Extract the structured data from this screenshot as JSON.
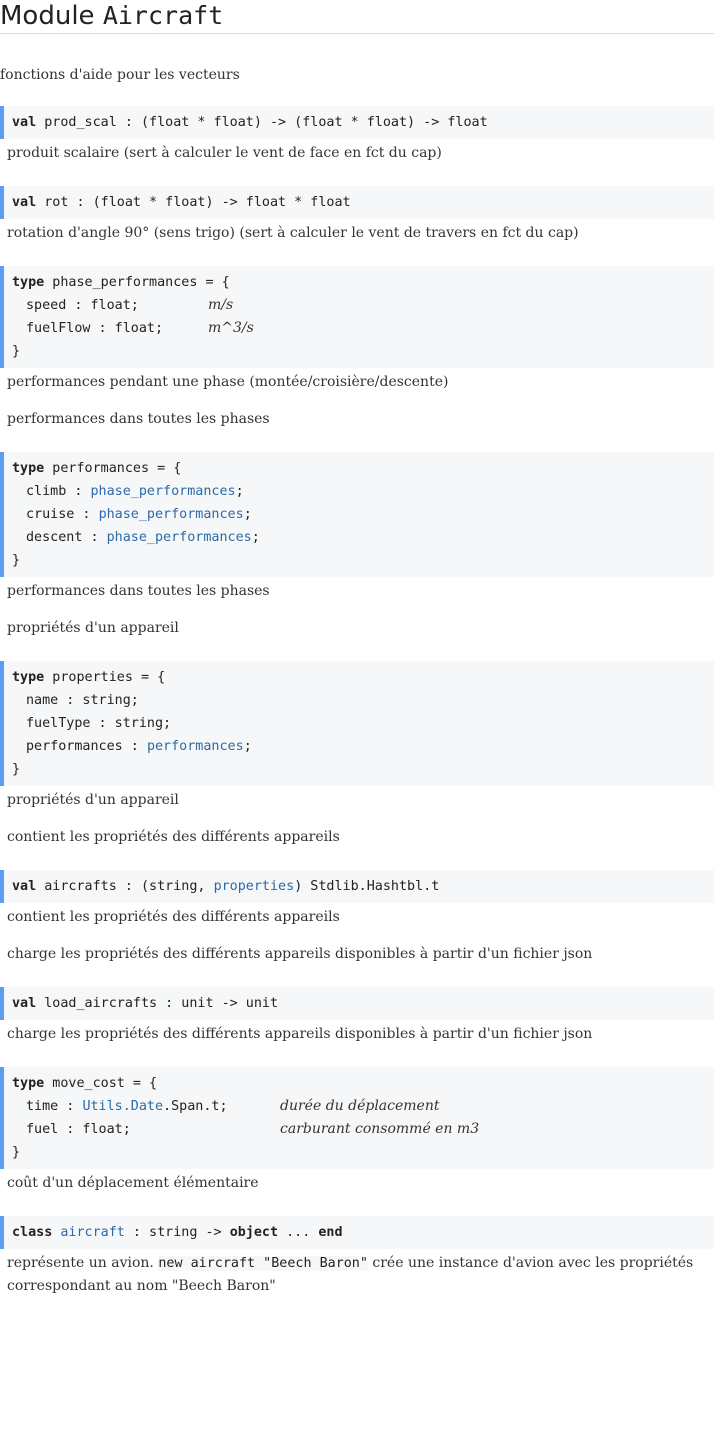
{
  "title": {
    "prefix": "Module",
    "name": "Aircraft"
  },
  "intro": "fonctions d'aide pour les vecteurs",
  "items": {
    "prod_scal": {
      "kw": "val",
      "sig": " prod_scal : (float * float) -> (float * float) -> float",
      "doc": "produit scalaire (sert à calculer le vent de face en fct du cap)"
    },
    "rot": {
      "kw": "val",
      "sig": " rot : (float * float) -> float * float",
      "doc": "rotation d'angle 90° (sens trigo) (sert à calculer le vent de travers en fct du cap)"
    },
    "phase_performances": {
      "kw": "type",
      "head": " phase_performances = {",
      "f1": "speed : float;",
      "c1": "m/s",
      "f2": "fuelFlow : float;",
      "c2": "m^3/s",
      "close": "}",
      "doc1": "performances pendant une phase (montée/croisière/descente)",
      "doc2": "performances dans toutes les phases"
    },
    "performances": {
      "kw": "type",
      "head": " performances = {",
      "f1a": "climb : ",
      "f1b": "phase_performances",
      "f2a": "cruise : ",
      "f2b": "phase_performances",
      "f3a": "descent : ",
      "f3b": "phase_performances",
      "semi": ";",
      "close": "}",
      "doc1": "performances dans toutes les phases",
      "doc2": "propriétés d'un appareil"
    },
    "properties": {
      "kw": "type",
      "head": " properties = {",
      "f1": "name : string;",
      "f2": "fuelType : string;",
      "f3a": "performances : ",
      "f3b": "performances",
      "semi": ";",
      "close": "}",
      "doc1": "propriétés d'un appareil",
      "doc2": "contient les propriétés des différents appareils"
    },
    "aircrafts": {
      "kw": "val",
      "sig_a": " aircrafts : (string, ",
      "sig_b": "properties",
      "sig_c": ") Stdlib.Hashtbl.t",
      "doc1": "contient les propriétés des différents appareils",
      "doc2": "charge les propriétés des différents appareils disponibles à partir d'un fichier json"
    },
    "load_aircrafts": {
      "kw": "val",
      "sig": " load_aircrafts : unit -> unit",
      "doc": "charge les propriétés des différents appareils disponibles à partir d'un fichier json"
    },
    "move_cost": {
      "kw": "type",
      "head": " move_cost = {",
      "f1a": "time : ",
      "f1b": "Utils.Date",
      "f1c": ".Span.t;",
      "c1": "durée du déplacement",
      "f2": "fuel : float;",
      "c2": "carburant consommé en m3",
      "close": "}",
      "doc": "coût d'un déplacement élémentaire"
    },
    "aircraft_class": {
      "kw": "class",
      "name": "aircraft",
      "sig_a": " : string -> ",
      "kw2": "object",
      "sig_b": " ... ",
      "kw3": "end",
      "doc_a": "représente un avion. ",
      "doc_code": "new aircraft \"Beech Baron\"",
      "doc_b": " crée une instance d'avion avec les propriétés correspondant au nom \"Beech Baron\""
    }
  }
}
